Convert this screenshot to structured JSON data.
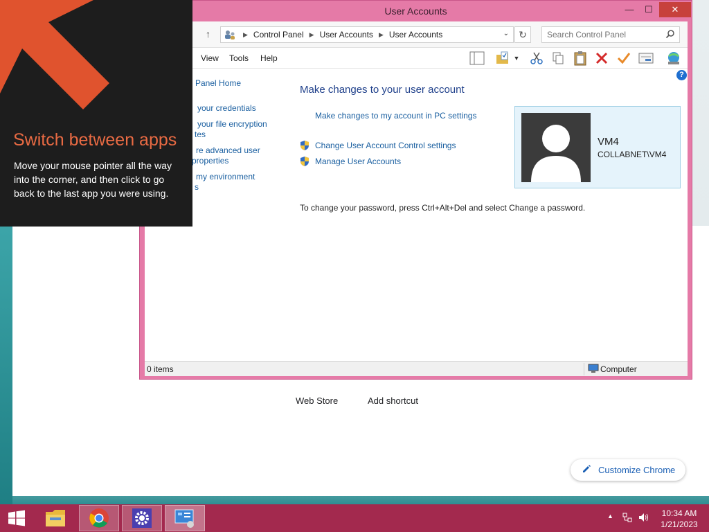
{
  "window": {
    "title": "User Accounts",
    "buttons": {
      "minimize": "—",
      "maximize": "☐",
      "close": "✕"
    }
  },
  "address": {
    "breadcrumbs": [
      "Control Panel",
      "User Accounts",
      "User Accounts"
    ],
    "search_placeholder": "Search Control Panel"
  },
  "menu": {
    "items": [
      "View",
      "Tools",
      "Help"
    ]
  },
  "left_nav": {
    "items": [
      "Panel Home",
      "your credentials",
      "your file encryption",
      "tes",
      "re advanced user",
      "properties",
      "my environment",
      "s"
    ]
  },
  "main": {
    "title": "Make changes to your user account",
    "link_pc_settings": "Make changes to my account in PC settings",
    "link_uac": "Change User Account Control settings",
    "link_manage": "Manage User Accounts",
    "password_note": "To change your password, press Ctrl+Alt+Del and select Change a password."
  },
  "user": {
    "name": "VM4",
    "domain": "COLLABNET\\VM4"
  },
  "status": {
    "items": "0 items",
    "location": "Computer"
  },
  "tip": {
    "title": "Switch between apps",
    "body": "Move your mouse pointer all the way into the corner, and then click to go back to the last app you were using."
  },
  "chrome_page": {
    "web_store": "Web Store",
    "add_shortcut": "Add shortcut",
    "customize": "Customize Chrome"
  },
  "taskbar": {
    "time": "10:34 AM",
    "date": "1/21/2023"
  },
  "colors": {
    "window_frame": "#e57aa7",
    "taskbar": "#a3294e",
    "tip_title": "#e86a43",
    "link": "#1a5fa0"
  }
}
